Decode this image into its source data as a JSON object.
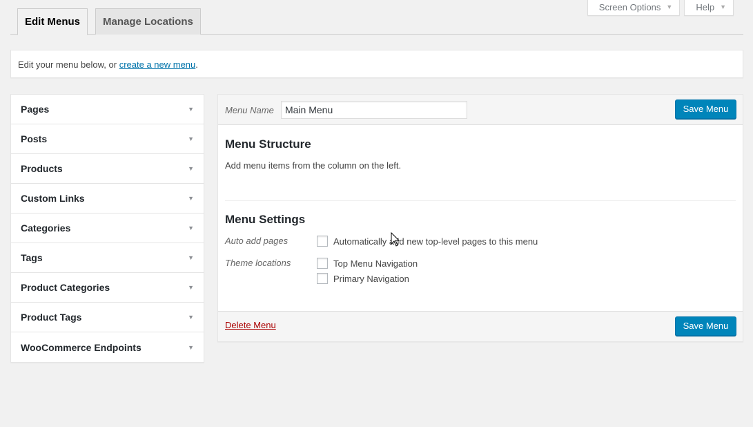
{
  "screen_meta": {
    "screen_options_label": "Screen Options",
    "help_label": "Help"
  },
  "tabs": [
    {
      "label": "Edit Menus",
      "active": true
    },
    {
      "label": "Manage Locations",
      "active": false
    }
  ],
  "notice": {
    "prefix": "Edit your menu below, or ",
    "link": "create a new menu",
    "suffix": "."
  },
  "accordion": [
    {
      "label": "Pages"
    },
    {
      "label": "Posts"
    },
    {
      "label": "Products"
    },
    {
      "label": "Custom Links"
    },
    {
      "label": "Categories"
    },
    {
      "label": "Tags"
    },
    {
      "label": "Product Categories"
    },
    {
      "label": "Product Tags"
    },
    {
      "label": "WooCommerce Endpoints"
    }
  ],
  "editor": {
    "menu_name_label": "Menu Name",
    "menu_name_value": "Main Menu",
    "save_label": "Save Menu",
    "structure_title": "Menu Structure",
    "structure_instructions": "Add menu items from the column on the left.",
    "settings_title": "Menu Settings",
    "auto_add_label": "Auto add pages",
    "auto_add_option": "Automatically add new top-level pages to this menu",
    "theme_locations_label": "Theme locations",
    "locations": [
      "Top Menu Navigation",
      "Primary Navigation"
    ],
    "delete_label": "Delete Menu"
  },
  "colors": {
    "primary_button": "#0085ba",
    "link": "#0073aa",
    "delete": "#aa0000"
  }
}
